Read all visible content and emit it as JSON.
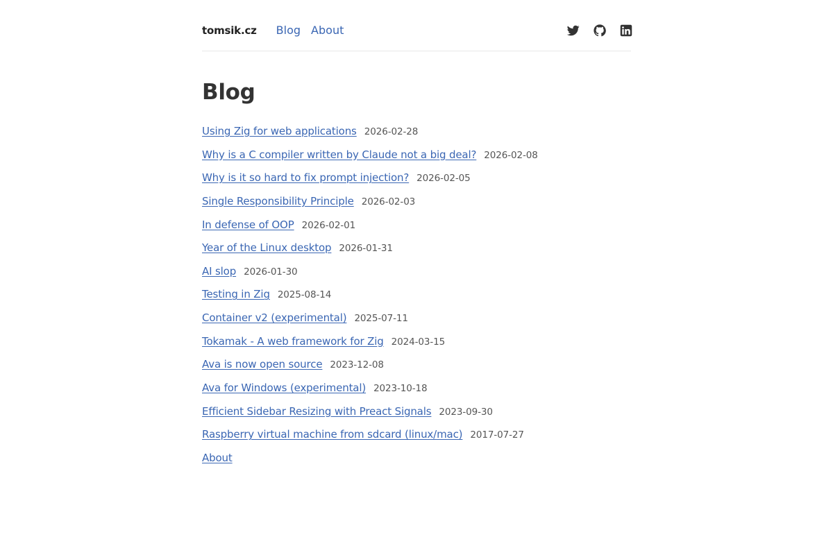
{
  "header": {
    "brand": "tomsik.cz",
    "nav": [
      {
        "label": "Blog"
      },
      {
        "label": "About"
      }
    ],
    "social": [
      {
        "icon": "twitter-icon"
      },
      {
        "icon": "github-icon"
      },
      {
        "icon": "linkedin-icon"
      }
    ]
  },
  "main": {
    "title": "Blog",
    "posts": [
      {
        "title": "Using Zig for web applications",
        "date": "2026-02-28"
      },
      {
        "title": "Why is a C compiler written by Claude not a big deal?",
        "date": "2026-02-08"
      },
      {
        "title": "Why is it so hard to fix prompt injection?",
        "date": "2026-02-05"
      },
      {
        "title": "Single Responsibility Principle",
        "date": "2026-02-03"
      },
      {
        "title": "In defense of OOP",
        "date": "2026-02-01"
      },
      {
        "title": "Year of the Linux desktop",
        "date": "2026-01-31"
      },
      {
        "title": "AI slop",
        "date": "2026-01-30"
      },
      {
        "title": "Testing in Zig",
        "date": "2025-08-14"
      },
      {
        "title": "Container v2 (experimental)",
        "date": "2025-07-11"
      },
      {
        "title": "Tokamak - A web framework for Zig",
        "date": "2024-03-15"
      },
      {
        "title": "Ava is now open source",
        "date": "2023-12-08"
      },
      {
        "title": "Ava for Windows (experimental)",
        "date": "2023-10-18"
      },
      {
        "title": "Efficient Sidebar Resizing with Preact Signals",
        "date": "2023-09-30"
      },
      {
        "title": "Raspberry virtual machine from sdcard (linux/mac)",
        "date": "2017-07-27"
      },
      {
        "title": "About",
        "date": ""
      }
    ]
  },
  "colors": {
    "link": "#3a66b3",
    "text": "#333333",
    "divider": "#e8e8e8"
  }
}
